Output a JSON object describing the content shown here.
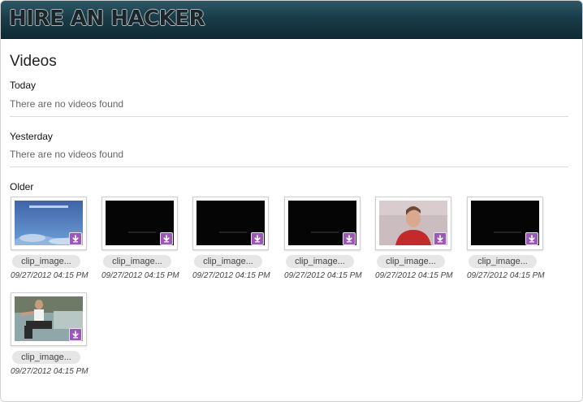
{
  "header": {
    "logo_text": "HIRE AN HACKER"
  },
  "page": {
    "title": "Videos"
  },
  "sections": {
    "today": {
      "title": "Today",
      "empty_text": "There are no videos found"
    },
    "yesterday": {
      "title": "Yesterday",
      "empty_text": "There are no videos found"
    },
    "older": {
      "title": "Older"
    }
  },
  "videos": [
    {
      "name": "clip_image...",
      "date": "09/27/2012 04:15 PM",
      "thumb": "sky-scene"
    },
    {
      "name": "clip_image...",
      "date": "09/27/2012 04:15 PM",
      "thumb": "black-frame"
    },
    {
      "name": "clip_image...",
      "date": "09/27/2012 04:15 PM",
      "thumb": "black-frame"
    },
    {
      "name": "clip_image...",
      "date": "09/27/2012 04:15 PM",
      "thumb": "black-frame"
    },
    {
      "name": "clip_image...",
      "date": "09/27/2012 04:15 PM",
      "thumb": "person-red-shirt"
    },
    {
      "name": "clip_image...",
      "date": "09/27/2012 04:15 PM",
      "thumb": "black-frame"
    },
    {
      "name": "clip_image...",
      "date": "09/27/2012 04:15 PM",
      "thumb": "man-on-couch"
    }
  ],
  "icons": {
    "download": "download-arrow-icon"
  },
  "colors": {
    "accent": "#9b59b6",
    "header": "#1a3c48"
  }
}
